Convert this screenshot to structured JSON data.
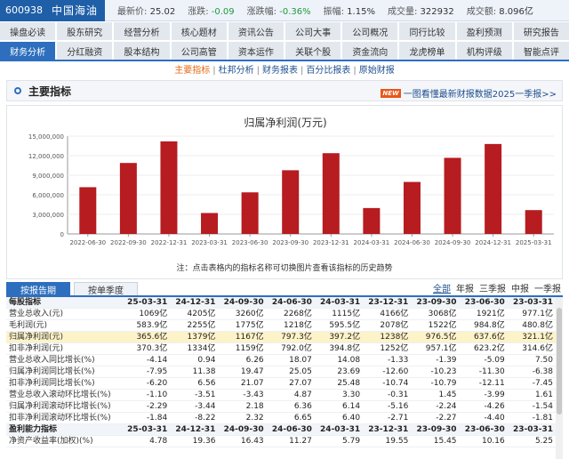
{
  "quote": {
    "code": "600938",
    "name": "中国海油",
    "items": [
      {
        "label": "最新价:",
        "value": "25.02",
        "tone": "v"
      },
      {
        "label": "涨跌:",
        "value": "-0.09",
        "tone": "down"
      },
      {
        "label": "涨跌幅:",
        "value": "-0.36%",
        "tone": "down"
      },
      {
        "label": "振幅:",
        "value": "1.15%",
        "tone": "v"
      },
      {
        "label": "成交量:",
        "value": "322932",
        "tone": "v"
      },
      {
        "label": "成交额:",
        "value": "8.096亿",
        "tone": "v"
      }
    ]
  },
  "nav": {
    "row1": [
      "操盘必读",
      "股东研究",
      "经营分析",
      "核心题材",
      "资讯公告",
      "公司大事",
      "公司概况",
      "同行比较",
      "盈利预测",
      "研究报告"
    ],
    "row2": [
      "财务分析",
      "分红融资",
      "股本结构",
      "公司高管",
      "资本运作",
      "关联个股",
      "资金流向",
      "龙虎榜单",
      "机构评级",
      "智能点评"
    ],
    "active": "财务分析"
  },
  "sublinks": [
    "主要指标",
    "杜邦分析",
    "财务报表",
    "百分比报表",
    "原始财报"
  ],
  "sublinks_active": "主要指标",
  "section": {
    "title": "主要指标",
    "promo_badge": "NEW",
    "promo_text": "一图看懂最新财报数据2025一季报>>"
  },
  "chart_data": {
    "type": "bar",
    "title": "归属净利润(万元)",
    "categories": [
      "2022-06-30",
      "2022-09-30",
      "2022-12-31",
      "2023-03-31",
      "2023-06-30",
      "2023-09-30",
      "2023-12-31",
      "2024-03-31",
      "2024-06-30",
      "2024-09-30",
      "2024-12-31",
      "2025-03-31"
    ],
    "values": [
      7168000,
      10880000,
      14190000,
      3210000,
      6376000,
      9765000,
      12380000,
      3972000,
      7973000,
      11670000,
      13790000,
      3656000
    ],
    "yticks": [
      "15,000,000",
      "12,000,000",
      "9,000,000",
      "6,000,000",
      "3,000,000",
      "0"
    ],
    "ylim": [
      0,
      15000000
    ],
    "color": "#b61c20",
    "grid": true
  },
  "note": "注：点击表格内的指标名称可切换图片查看该指标的历史趋势",
  "tabs": [
    "按报告期",
    "按单季度"
  ],
  "tabs_active": "按报告期",
  "periods": [
    "全部",
    "年报",
    "三季报",
    "中报",
    "一季报"
  ],
  "periods_active": "全部",
  "table": {
    "columns": [
      "25-03-31",
      "24-12-31",
      "24-09-30",
      "24-06-30",
      "24-03-31",
      "23-12-31",
      "23-09-30",
      "23-06-30",
      "23-03-31"
    ],
    "rows": [
      {
        "type": "head",
        "label": "每股指标",
        "cells": [
          "25-03-31",
          "24-12-31",
          "24-09-30",
          "24-06-30",
          "24-03-31",
          "23-12-31",
          "23-09-30",
          "23-06-30",
          "23-03-31"
        ]
      },
      {
        "label": "营业总收入(元)",
        "cells": [
          "1069亿",
          "4205亿",
          "3260亿",
          "2268亿",
          "1115亿",
          "4166亿",
          "3068亿",
          "1921亿",
          "977.1亿"
        ]
      },
      {
        "label": "毛利润(元)",
        "cells": [
          "583.9亿",
          "2255亿",
          "1775亿",
          "1218亿",
          "595.5亿",
          "2078亿",
          "1522亿",
          "984.8亿",
          "480.8亿"
        ]
      },
      {
        "type": "hl",
        "label": "归属净利润(元)",
        "cells": [
          "365.6亿",
          "1379亿",
          "1167亿",
          "797.3亿",
          "397.2亿",
          "1238亿",
          "976.5亿",
          "637.6亿",
          "321.1亿"
        ]
      },
      {
        "label": "扣非净利润(元)",
        "cells": [
          "370.3亿",
          "1334亿",
          "1159亿",
          "792.0亿",
          "394.8亿",
          "1252亿",
          "957.1亿",
          "623.2亿",
          "314.6亿"
        ]
      },
      {
        "label": "营业总收入同比增长(%)",
        "cells": [
          "-4.14",
          "0.94",
          "6.26",
          "18.07",
          "14.08",
          "-1.33",
          "-1.39",
          "-5.09",
          "7.50"
        ]
      },
      {
        "label": "归属净利润同比增长(%)",
        "cells": [
          "-7.95",
          "11.38",
          "19.47",
          "25.05",
          "23.69",
          "-12.60",
          "-10.23",
          "-11.30",
          "-6.38"
        ]
      },
      {
        "label": "扣非净利润同比增长(%)",
        "cells": [
          "-6.20",
          "6.56",
          "21.07",
          "27.07",
          "25.48",
          "-10.74",
          "-10.79",
          "-12.11",
          "-7.45"
        ]
      },
      {
        "label": "营业总收入滚动环比增长(%)",
        "cells": [
          "-1.10",
          "-3.51",
          "-3.43",
          "4.87",
          "3.30",
          "-0.31",
          "1.45",
          "-3.99",
          "1.61"
        ]
      },
      {
        "label": "归属净利润滚动环比增长(%)",
        "cells": [
          "-2.29",
          "-3.44",
          "2.18",
          "6.36",
          "6.14",
          "-5.16",
          "-2.24",
          "-4.26",
          "-1.54"
        ]
      },
      {
        "label": "扣非净利润滚动环比增长(%)",
        "cells": [
          "-1.84",
          "-8.22",
          "2.32",
          "6.65",
          "6.40",
          "-2.71",
          "-2.27",
          "-4.40",
          "-1.81"
        ]
      },
      {
        "type": "head",
        "label": "盈利能力指标",
        "cells": [
          "25-03-31",
          "24-12-31",
          "24-09-30",
          "24-06-30",
          "24-03-31",
          "23-12-31",
          "23-09-30",
          "23-06-30",
          "23-03-31"
        ]
      },
      {
        "label": "净资产收益率(加权)(%)",
        "cells": [
          "4.78",
          "19.36",
          "16.43",
          "11.27",
          "5.79",
          "19.55",
          "15.45",
          "10.16",
          "5.25"
        ]
      }
    ]
  }
}
